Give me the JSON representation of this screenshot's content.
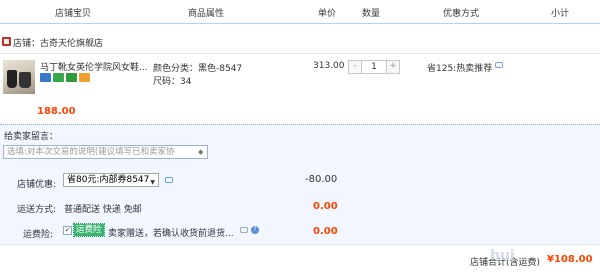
{
  "header": {
    "columns": [
      "店铺宝贝",
      "商品属性",
      "单价",
      "数量",
      "优惠方式",
      "小计"
    ]
  },
  "shop": {
    "icon": "shop-icon",
    "label": "店铺：古奇天伦旗舰店"
  },
  "item": {
    "title": "马丁靴女英伦学院风女鞋...",
    "badges": [
      "blue-badge-icon",
      "green-badge-icon",
      "green-badge-icon",
      "orange-badge-icon"
    ],
    "attr_color": "颜色分类：黑色-8547",
    "attr_size": "尺码：34",
    "price": "313.00",
    "quantity": "1",
    "qty_minus": "-",
    "qty_plus": "+",
    "promo": "省125:热卖推荐",
    "subtotal": "188.00"
  },
  "message": {
    "label": "给卖家留言：",
    "placeholder": "选填:对本次交易的说明(建议填写已和卖家协"
  },
  "coupon": {
    "label": "店铺优惠:",
    "selected": "省80元:内部券8547",
    "amount": "-80.00"
  },
  "shipping": {
    "label": "运送方式:",
    "value": "普通配送 快递 免邮",
    "amount": "0.00"
  },
  "insurance": {
    "label": "运费险:",
    "tag": "运费险",
    "text": "卖家赠送，若确认收货前退货...",
    "question": "?",
    "amount": "0.00"
  },
  "footer": {
    "total_label": "店铺合计(含运费)",
    "total_value": "¥108.00"
  },
  "watermark": "hui"
}
